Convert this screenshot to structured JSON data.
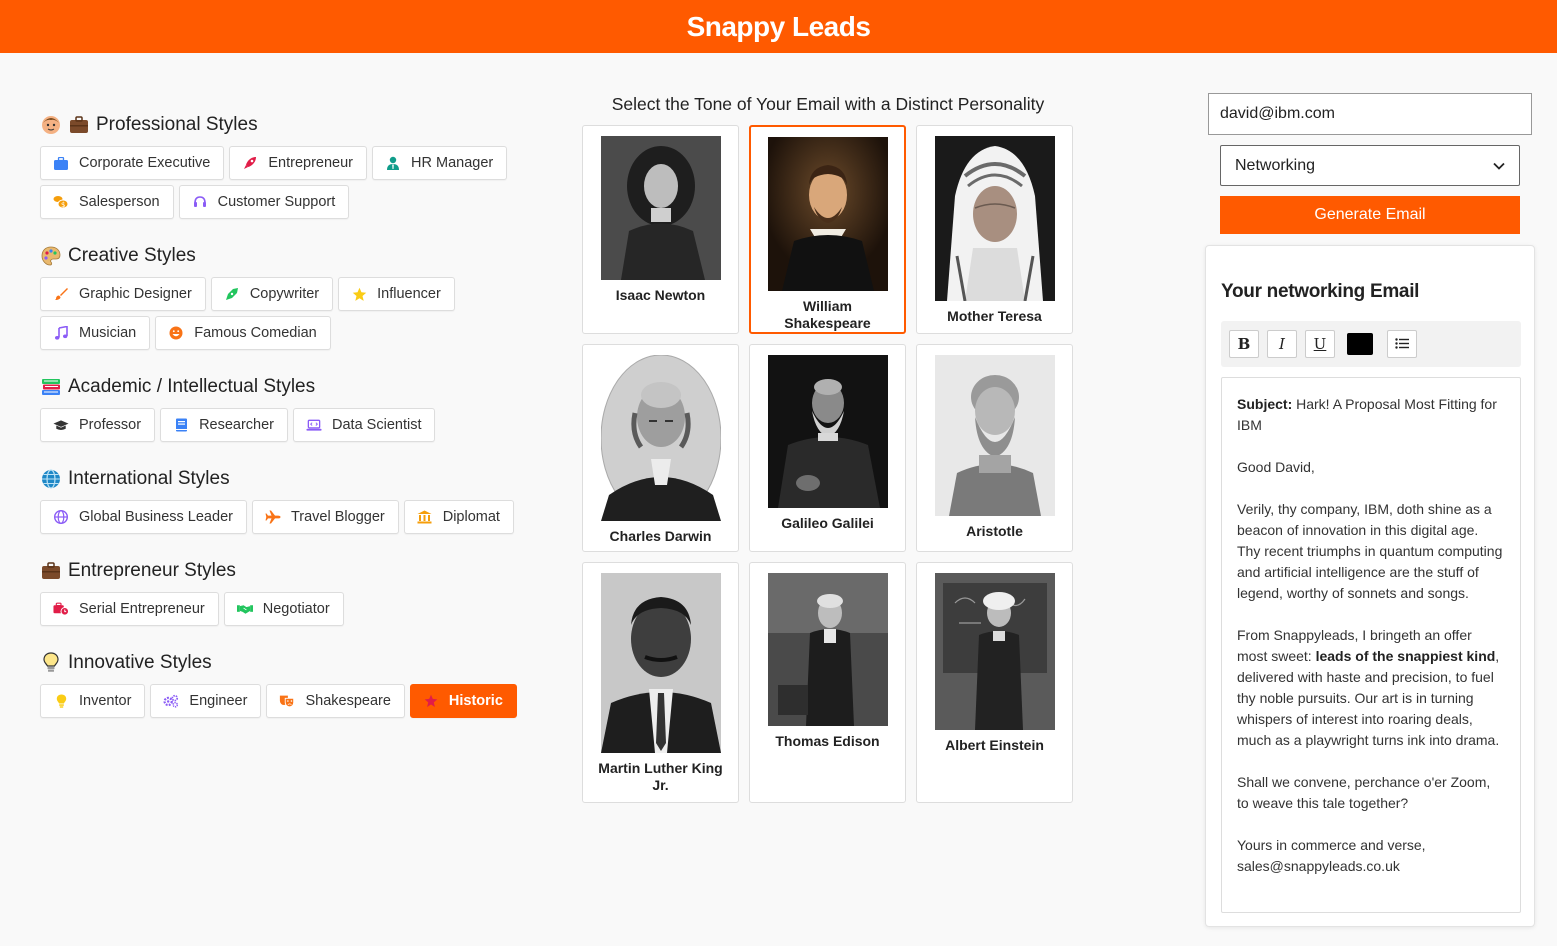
{
  "app": {
    "title": "Snappy Leads"
  },
  "groups": [
    {
      "title": "Professional Styles",
      "icon": "person-briefcase-icon",
      "items": [
        {
          "label": "Corporate Executive",
          "icon": "briefcase-icon",
          "color": "#3b82f6"
        },
        {
          "label": "Entrepreneur",
          "icon": "rocket-icon",
          "color": "#e11d48"
        },
        {
          "label": "HR Manager",
          "icon": "user-tie-icon",
          "color": "#0f9d8a"
        },
        {
          "label": "Salesperson",
          "icon": "coins-icon",
          "color": "#f59e0b"
        },
        {
          "label": "Customer Support",
          "icon": "headset-icon",
          "color": "#8b5cf6"
        }
      ]
    },
    {
      "title": "Creative Styles",
      "icon": "palette-icon",
      "items": [
        {
          "label": "Graphic Designer",
          "icon": "paintbrush-icon",
          "color": "#f97316"
        },
        {
          "label": "Copywriter",
          "icon": "pen-nib-icon",
          "color": "#22c55e"
        },
        {
          "label": "Influencer",
          "icon": "star-icon",
          "color": "#facc15"
        },
        {
          "label": "Musician",
          "icon": "music-icon",
          "color": "#8b5cf6"
        },
        {
          "label": "Famous Comedian",
          "icon": "laugh-icon",
          "color": "#f97316"
        }
      ]
    },
    {
      "title": "Academic / Intellectual Styles",
      "icon": "books-icon",
      "items": [
        {
          "label": "Professor",
          "icon": "graduation-cap-icon",
          "color": "#333333"
        },
        {
          "label": "Researcher",
          "icon": "book-icon",
          "color": "#3b82f6"
        },
        {
          "label": "Data Scientist",
          "icon": "laptop-code-icon",
          "color": "#8b5cf6"
        }
      ]
    },
    {
      "title": "International Styles",
      "icon": "globe-icon",
      "items": [
        {
          "label": "Global Business Leader",
          "icon": "globe-icon",
          "color": "#8b5cf6"
        },
        {
          "label": "Travel Blogger",
          "icon": "plane-icon",
          "color": "#f97316"
        },
        {
          "label": "Diplomat",
          "icon": "landmark-icon",
          "color": "#f59e0b"
        }
      ]
    },
    {
      "title": "Entrepreneur Styles",
      "icon": "briefcase-icon",
      "items": [
        {
          "label": "Serial Entrepreneur",
          "icon": "business-time-icon",
          "color": "#e11d48"
        },
        {
          "label": "Negotiator",
          "icon": "handshake-icon",
          "color": "#22c55e"
        }
      ]
    },
    {
      "title": "Innovative Styles",
      "icon": "lightbulb-icon",
      "items": [
        {
          "label": "Inventor",
          "icon": "lightbulb-icon",
          "color": "#facc15"
        },
        {
          "label": "Engineer",
          "icon": "cogs-icon",
          "color": "#8b5cf6"
        },
        {
          "label": "Shakespeare",
          "icon": "theater-masks-icon",
          "color": "#f97316"
        },
        {
          "label": "Historic",
          "icon": "star-icon",
          "color": "#e11d48",
          "active": true
        }
      ]
    }
  ],
  "personalities": {
    "title": "Select the Tone of Your Email with a Distinct Personality",
    "cards": [
      {
        "name": "Isaac Newton",
        "selected": false
      },
      {
        "name": "William Shakespeare",
        "selected": true
      },
      {
        "name": "Mother Teresa",
        "selected": false
      },
      {
        "name": "Charles Darwin",
        "selected": false
      },
      {
        "name": "Galileo Galilei",
        "selected": false
      },
      {
        "name": "Aristotle",
        "selected": false
      },
      {
        "name": "Martin Luther King Jr.",
        "selected": false
      },
      {
        "name": "Thomas Edison",
        "selected": false
      },
      {
        "name": "Albert Einstein",
        "selected": false
      }
    ]
  },
  "form": {
    "email_value": "david@ibm.com",
    "type_selected": "Networking",
    "generate_label": "Generate Email"
  },
  "output": {
    "title": "Your networking Email",
    "toolbar": {
      "bold": "B",
      "italic": "I",
      "underline": "U",
      "color": "#000000"
    },
    "subject_label": "Subject:",
    "subject": "Hark! A Proposal Most Fitting for IBM",
    "greeting": "Good David,",
    "p1": "Verily, thy company, IBM, doth shine as a beacon of innovation in this digital age. Thy recent triumphs in quantum computing and artificial intelligence are the stuff of legend, worthy of sonnets and songs.",
    "p2_before": "From Snappyleads, I bringeth an offer most sweet: ",
    "p2_bold": "leads of the snappiest kind",
    "p2_after": ", delivered with haste and precision, to fuel thy noble pursuits. Our art is in turning whispers of interest into roaring deals, much as a playwright turns ink into drama.",
    "p3": "Shall we convene, perchance o'er Zoom, to weave this tale together?",
    "sign_line1": "Yours in commerce and verse,",
    "sign_line2": "sales@snappyleads.co.uk"
  }
}
